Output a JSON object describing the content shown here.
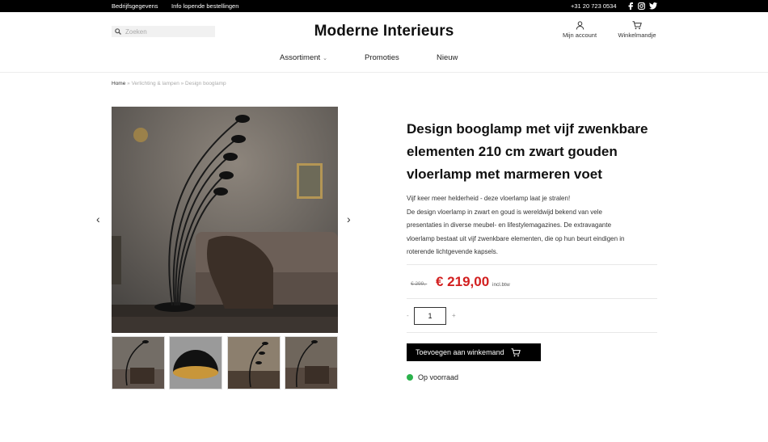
{
  "topbar": {
    "links": [
      "Bedrijfsgegevens",
      "Info lopende bestellingen"
    ],
    "phone": "+31 20 723 0534",
    "social_icons": [
      "facebook-icon",
      "instagram-icon",
      "twitter-icon"
    ]
  },
  "header": {
    "search_placeholder": "Zoeken",
    "logo": "Moderne Interieurs",
    "account_label": "Mijn account",
    "cart_label": "Winkelmandje"
  },
  "nav": {
    "items": [
      "Assortiment",
      "Promoties",
      "Nieuw"
    ]
  },
  "breadcrumb": {
    "home": "Home",
    "rest": " » Verlichting & lampen » Design booglamp"
  },
  "product": {
    "title": "Design booglamp met vijf zwenkbare elementen 210 cm zwart gouden vloerlamp met marmeren voet",
    "description": [
      "Vijf keer meer helderheid - deze vloerlamp laat je stralen!",
      "De design vloerlamp  in zwart en goud is wereldwijd bekend van vele",
      "presentaties in diverse meubel- en lifestylemagazines. De extravagante",
      "vloerlamp bestaat uit vijf zwenkbare elementen, die op hun beurt eindigen in",
      "roterende lichtgevende kapsels."
    ],
    "old_price": "€ 299,-",
    "price": "€ 219,00",
    "vat_note": "incl.btw",
    "quantity": "1",
    "minus": "-",
    "plus": "+",
    "add_to_cart": "Toevoegen aan winkemand",
    "stock": "Op voorraad"
  },
  "gallery": {
    "prev_icon": "‹",
    "next_icon": "›",
    "thumbnail_count": 4
  },
  "colors": {
    "topbar": "#000000",
    "price": "#d21f1f",
    "stock": "#2bb24c"
  }
}
